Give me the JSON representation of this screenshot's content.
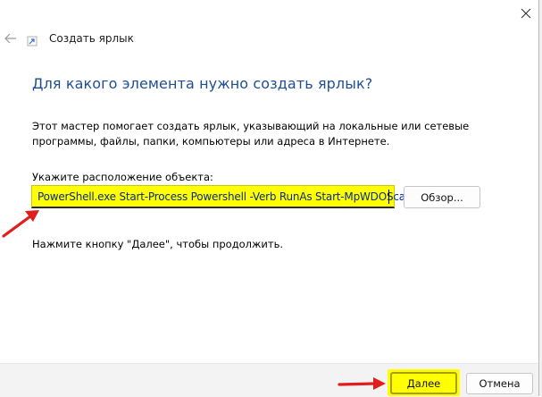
{
  "dialog": {
    "title": "Создать ярлык",
    "heading": "Для какого элемента нужно создать ярлык?",
    "description": "Этот мастер помогает создать ярлык, указывающий на локальные или сетевые программы, файлы, папки, компьютеры или адреса в Интернете.",
    "location_label": "Укажите расположение объекта:",
    "location_value": "PowerShell.exe Start-Process Powershell -Verb RunAs Start-MpWDOScan",
    "browse_label": "Обзор...",
    "hint": "Нажмите кнопку \"Далее\", чтобы продолжить.",
    "next_label": "Далее",
    "cancel_label": "Отмена"
  },
  "icons": {
    "close": "close-icon",
    "back": "back-arrow-icon",
    "app": "shortcut-icon"
  },
  "colors": {
    "heading": "#1f4e94",
    "highlight": "#ffff00",
    "annotation_arrow": "#e01e1e",
    "input_text": "#0a2b8e"
  }
}
